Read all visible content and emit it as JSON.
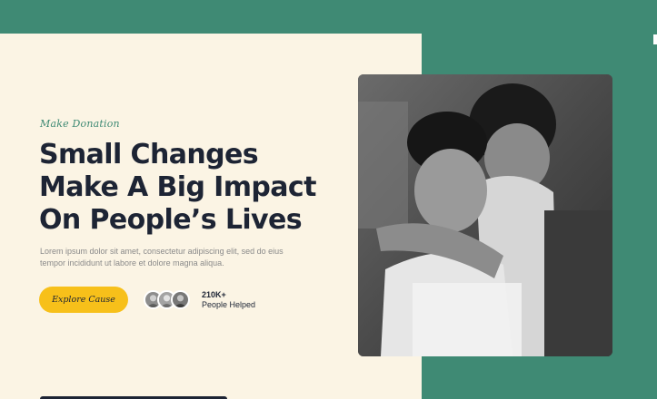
{
  "hero": {
    "eyebrow": "Make Donation",
    "headline_lines": [
      "Small Changes",
      "Make A Big Impact",
      "On People’s Lives"
    ],
    "body": "Lorem ipsum dolor sit amet, consectetur adipiscing elit, sed do eius tempor incididunt ut labore et dolore magna aliqua.",
    "cta_label": "Explore Cause",
    "stat_count": "210K+",
    "stat_label": "People Helped"
  },
  "colors": {
    "accent_green": "#3f8a74",
    "cream": "#fbf4e4",
    "cta_yellow": "#f7c01a",
    "heading_navy": "#1d2434"
  },
  "icons": [
    "avatar-photo",
    "avatar-photo",
    "avatar-photo",
    "children-photo"
  ]
}
